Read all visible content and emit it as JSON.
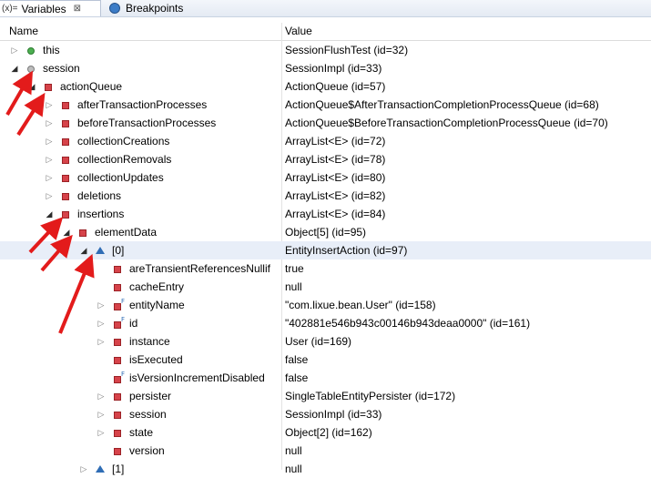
{
  "tabs": [
    {
      "label": "Variables",
      "icon": "variables-icon",
      "close": "⊠",
      "prefix": "(x)="
    },
    {
      "label": "Breakpoints",
      "icon": "breakpoints-icon"
    }
  ],
  "columns": {
    "name": "Name",
    "value": "Value"
  },
  "rows": [
    {
      "name": "this",
      "value": "SessionFlushTest  (id=32)"
    },
    {
      "name": "session",
      "value": "SessionImpl  (id=33)"
    },
    {
      "name": "actionQueue",
      "value": "ActionQueue  (id=57)"
    },
    {
      "name": "afterTransactionProcesses",
      "value": "ActionQueue$AfterTransactionCompletionProcessQueue  (id=68)"
    },
    {
      "name": "beforeTransactionProcesses",
      "value": "ActionQueue$BeforeTransactionCompletionProcessQueue  (id=70)"
    },
    {
      "name": "collectionCreations",
      "value": "ArrayList<E>  (id=72)"
    },
    {
      "name": "collectionRemovals",
      "value": "ArrayList<E>  (id=78)"
    },
    {
      "name": "collectionUpdates",
      "value": "ArrayList<E>  (id=80)"
    },
    {
      "name": "deletions",
      "value": "ArrayList<E>  (id=82)"
    },
    {
      "name": "insertions",
      "value": "ArrayList<E>  (id=84)"
    },
    {
      "name": "elementData",
      "value": "Object[5]  (id=95)"
    },
    {
      "name": "[0]",
      "value": "EntityInsertAction  (id=97)"
    },
    {
      "name": "areTransientReferencesNullif",
      "value": "true"
    },
    {
      "name": "cacheEntry",
      "value": "null"
    },
    {
      "name": "entityName",
      "value": "\"com.lixue.bean.User\" (id=158)"
    },
    {
      "name": "id",
      "value": "\"402881e546b943c00146b943deaa0000\" (id=161)"
    },
    {
      "name": "instance",
      "value": "User  (id=169)"
    },
    {
      "name": "isExecuted",
      "value": "false"
    },
    {
      "name": "isVersionIncrementDisabled",
      "value": "false"
    },
    {
      "name": "persister",
      "value": "SingleTableEntityPersister  (id=172)"
    },
    {
      "name": "session",
      "value": "SessionImpl  (id=33)"
    },
    {
      "name": "state",
      "value": "Object[2]  (id=162)"
    },
    {
      "name": "version",
      "value": "null"
    },
    {
      "name": "[1]",
      "value": "null"
    }
  ]
}
